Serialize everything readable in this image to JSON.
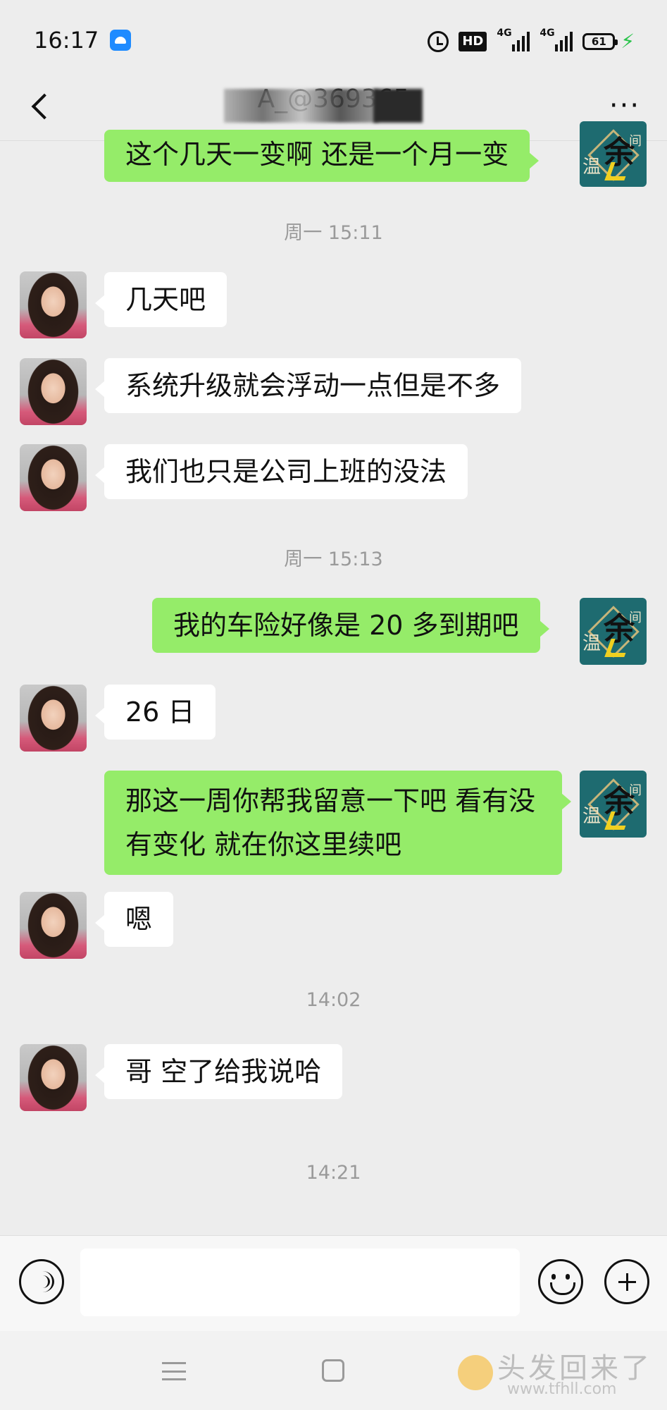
{
  "status_bar": {
    "time": "16:17",
    "hd": "HD",
    "net1": "4G",
    "net2": "4G",
    "battery": "61"
  },
  "header": {
    "title": "A_@369365",
    "back_icon": "chevron-left-icon",
    "more_label": "···"
  },
  "colors": {
    "background": "#ededed",
    "sent_bubble": "#95ec69",
    "received_bubble": "#ffffff",
    "timestamp": "#9a9a9a"
  },
  "messages": {
    "m0": "这个几天一变啊 还是一个月一变",
    "t1": "周一 15:11",
    "m1": "几天吧",
    "m2": "系统升级就会浮动一点但是不多",
    "m3": "我们也只是公司上班的没法",
    "t2": "周一 15:13",
    "m4": "我的车险好像是 20 多到期吧",
    "m5": "26 日",
    "m6": "那这一周你帮我留意一下吧 看有没有变化 就在你这里续吧",
    "m7": "嗯",
    "t3": "14:02",
    "m8": "哥 空了给我说哈",
    "t4": "14:21"
  },
  "input_bar": {
    "value": "",
    "voice_icon": "voice-icon",
    "emoji_icon": "emoji-icon",
    "plus_icon": "plus-icon"
  },
  "watermark": {
    "text": "头发回来了",
    "url": "www.tfhll.com"
  }
}
